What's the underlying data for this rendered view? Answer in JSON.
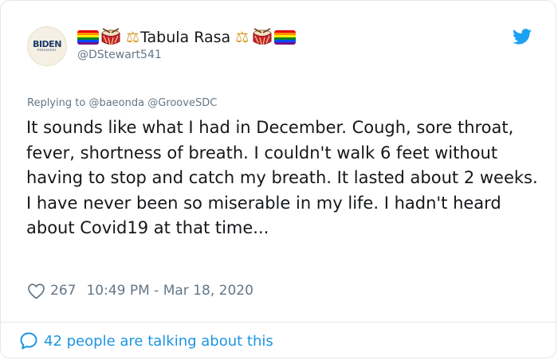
{
  "tweet": {
    "avatar_logo": "BIDEN",
    "avatar_sub": "PRESIDENT",
    "display_name": "Tabula Rasa",
    "handle": "@DStewart541",
    "reply_prefix": "Replying to",
    "reply_mention_1": "@baeonda",
    "reply_mention_2": "@GrooveSDC",
    "text": "It sounds like what I had in December. Cough, sore throat, fever, shortness of breath. I couldn't walk 6 feet without having to stop and catch my breath. It lasted about 2 weeks. I have never been so miserable in my life. I hadn't heard about Covid19 at that time...",
    "likes": "267",
    "timestamp": "10:49 PM - Mar 18, 2020",
    "talking": "42 people are talking about this"
  },
  "icons": {
    "brand": "twitter-bird-icon",
    "like": "heart-icon",
    "reply": "speech-bubble-icon"
  },
  "colors": {
    "twitter_blue": "#1da1f2",
    "link_blue": "#1b95e0",
    "text": "#14171a",
    "muted": "#657786"
  }
}
